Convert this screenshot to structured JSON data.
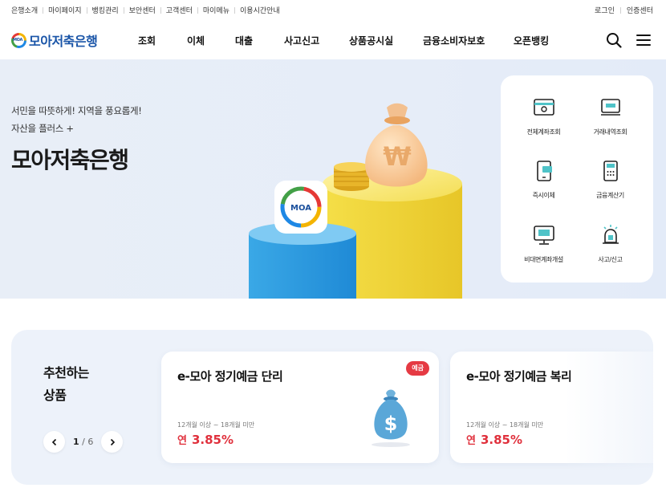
{
  "util_nav": {
    "left": [
      "은행소개",
      "마이페이지",
      "뱅킹관리",
      "보안센터",
      "고객센터",
      "마이메뉴",
      "이용시간안내"
    ],
    "right": [
      "로그인",
      "인증센터"
    ]
  },
  "header": {
    "logo_mark_text": "MOA",
    "logo_text": "모아저축은행",
    "menu": [
      "조회",
      "이체",
      "대출",
      "사고신고",
      "상품공시실",
      "금융소비자보호",
      "오픈뱅킹"
    ],
    "search_icon": "search-icon",
    "menu_icon": "hamburger-icon"
  },
  "hero": {
    "sub1": "서민을 따뜻하게! 지역을 풍요롭게!",
    "sub2": "자산을 플러스 +",
    "title": "모아저축은행",
    "badge_text": "MOA",
    "bag_symbol": "₩"
  },
  "quick_menu": [
    {
      "label": "전체계좌조회",
      "icon": "account-lookup-icon"
    },
    {
      "label": "거래내역조회",
      "icon": "transaction-history-icon"
    },
    {
      "label": "즉시이체",
      "icon": "instant-transfer-icon"
    },
    {
      "label": "금융계산기",
      "icon": "calculator-icon"
    },
    {
      "label": "비대면계좌개설",
      "icon": "remote-account-icon"
    },
    {
      "label": "사고/신고",
      "icon": "alarm-icon"
    }
  ],
  "recommend": {
    "title_line1": "추천하는",
    "title_line2": "상품",
    "pager_current": "1",
    "pager_sep": "/",
    "pager_total": "6",
    "cards": [
      {
        "title": "e-모아 정기예금 단리",
        "badge": "예금",
        "condition": "12개월 이상 ~ 18개월 미만",
        "rate_prefix": "연",
        "rate": "3.85%"
      },
      {
        "title": "e-모아 정기예금 복리",
        "condition": "12개월 이상 ~ 18개월 미만",
        "rate_prefix": "연",
        "rate": "3.85%"
      }
    ],
    "card_symbol": "$"
  },
  "colors": {
    "brand": "#1a55a8",
    "rate_red": "#e0303c",
    "hero_bg": "#e6edf8"
  }
}
